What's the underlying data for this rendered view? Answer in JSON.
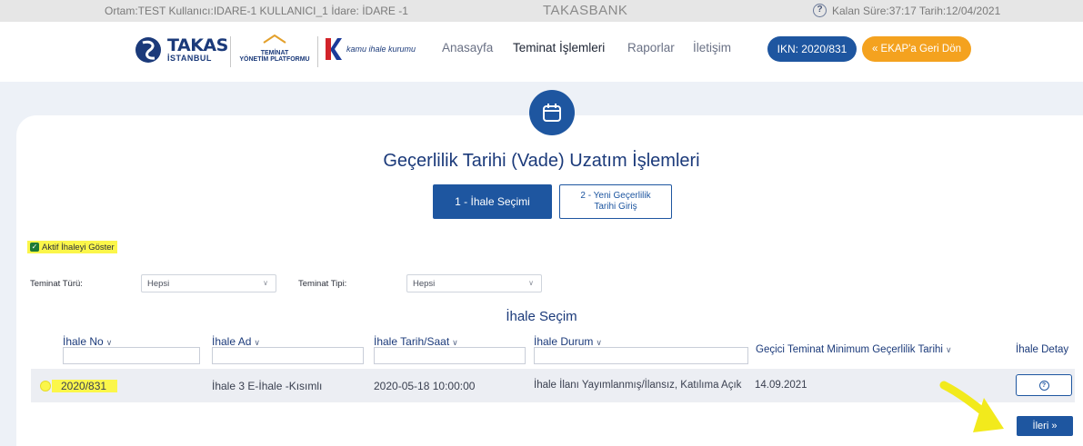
{
  "topbar": {
    "env_text": "Ortam:TEST  Kullanıcı:IDARE-1 KULLANICI_1  İdare: İDARE -1",
    "brand": "TAKASBANK",
    "help_icon": "?",
    "timer_text": "Kalan Süre:37:17  Tarih:12/04/2021"
  },
  "header": {
    "logo_takas_line1": "TAKAS",
    "logo_takas_line2": "İSTANBUL",
    "logo_typ_line1": "TEMİNAT",
    "logo_typ_line2": "YÖNETİM PLATFORMU",
    "logo_kik_text": "kamu ihale kurumu",
    "nav": [
      "Anasayfa",
      "Teminat İşlemleri",
      "Raporlar",
      "İletişim"
    ],
    "ikn_label": "IKN: 2020/831",
    "ekap_label": "« EKAP'a Geri Dön"
  },
  "page": {
    "title": "Geçerlilik Tarihi (Vade) Uzatım İşlemleri",
    "step1": "1 - İhale Seçimi",
    "step2_line1": "2 - Yeni Geçerlilik",
    "step2_line2": "Tarihi Giriş",
    "aktif_label": "Aktif İhaleyi Göster"
  },
  "filters": {
    "teminat_turu_label": "Teminat Türü:",
    "teminat_turu_value": "Hepsi",
    "teminat_tipi_label": "Teminat Tipi:",
    "teminat_tipi_value": "Hepsi"
  },
  "table": {
    "section_title": "İhale Seçim",
    "headers": [
      "İhale No",
      "İhale Ad",
      "İhale Tarih/Saat",
      "İhale Durum",
      "Geçici Teminat Minimum Geçerlilik Tarihi",
      "İhale Detay"
    ],
    "rows": [
      {
        "ihale_no": "2020/831",
        "ihale_ad": "İhale 3 E-İhale -Kısımlı",
        "tarih": "2020-05-18 10:00:00",
        "durum": "İhale İlanı Yayımlanmış/İlansız, Katılıma Açık",
        "gecerlilik": "14.09.2021"
      }
    ]
  },
  "footer": {
    "next_label": "İleri  »"
  },
  "colors": {
    "primary": "#1e56a0",
    "accent": "#f4a21f",
    "highlight": "#fbf64a",
    "annotation_arrow": "#f2ea1c"
  },
  "icons": {
    "calendar": "calendar-icon",
    "help": "question-circle-icon",
    "chevron": "chevron-down-icon"
  }
}
